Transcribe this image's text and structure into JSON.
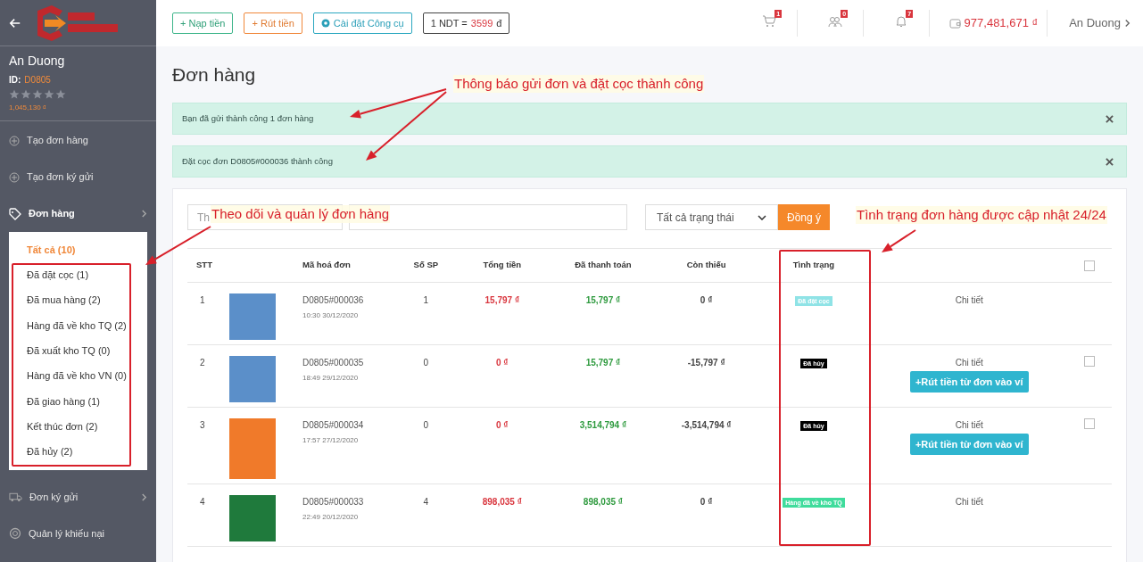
{
  "topbar": {
    "buttons": [
      {
        "label": "+ Nạp tiền",
        "kind": "deposit"
      },
      {
        "label": "+ Rút tiền",
        "kind": "withdraw"
      },
      {
        "label": "Cài đặt Công cụ",
        "kind": "tool"
      }
    ],
    "rate": {
      "label": "1 NDT =",
      "value": "3599",
      "unit": "đ"
    },
    "badges": [
      {
        "kind": "cart",
        "count": "1"
      },
      {
        "kind": "users",
        "count": "0"
      },
      {
        "kind": "bell",
        "count": "7"
      }
    ],
    "wallet": "977,481,671 ₫",
    "user": "An Duong"
  },
  "sidebar": {
    "name": "An Duong",
    "id_label": "ID:",
    "id": "D0805",
    "stars": 0,
    "balance": "1,045,130 ₫",
    "items": [
      {
        "label": "Tạo đơn hàng",
        "kind": "create",
        "expanded": false
      },
      {
        "label": "Tạo đơn ký gửi",
        "kind": "create",
        "expanded": false
      },
      {
        "label": "Đơn hàng",
        "kind": "orders",
        "expanded": true,
        "children": [
          {
            "label": "Tất cả (10)",
            "selected": true
          },
          {
            "label": "Đã đặt cọc (1)",
            "selected": false
          },
          {
            "label": "Đã mua hàng (2)",
            "selected": false
          },
          {
            "label": "Hàng đã về kho TQ (2)",
            "selected": false
          },
          {
            "label": "Đã xuất kho TQ (0)",
            "selected": false
          },
          {
            "label": "Hàng đã về kho VN (0)",
            "selected": false
          },
          {
            "label": "Đã giao hàng (1)",
            "selected": false
          },
          {
            "label": "Kết thúc đơn (2)",
            "selected": false
          },
          {
            "label": "Đã hủy (2)",
            "selected": false
          }
        ]
      },
      {
        "label": "Đơn ký gửi",
        "kind": "consignment",
        "expanded": false
      },
      {
        "label": "Quản lý khiếu nại",
        "kind": "complaints",
        "expanded": false
      }
    ]
  },
  "page_title": "Đơn hàng",
  "alerts": [
    "Bạn đã gửi thành công 1 đơn hàng",
    "Đặt cọc đơn D0805#000036 thành công"
  ],
  "filters": {
    "time_placeholder": "Th",
    "status_select": "Tất cả trạng thái",
    "submit": "Đồng ý"
  },
  "table": {
    "columns": [
      "STT",
      "Mã hoá đơn",
      "Số SP",
      "Tổng tiền",
      "Đã thanh toán",
      "Còn thiếu",
      "Tình trạng"
    ],
    "header_checked": false,
    "rows": [
      {
        "stt": "1",
        "code": "D0805#000036",
        "time": "10:30 30/12/2020",
        "qty": "1",
        "total": "15,797 ₫",
        "paid": "15,797 ₫",
        "owed": "0 ₫",
        "status": "Đã đặt cọc",
        "color": "#8fe3e6",
        "detail": "Chi tiết"
      },
      {
        "stt": "2",
        "code": "D0805#000035",
        "time": "18:49 29/12/2020",
        "qty": "0",
        "total": "0 ₫",
        "paid": "15,797 ₫",
        "owed": "-15,797 ₫",
        "status": "Đã hủy",
        "color": "#000000",
        "detail": "Chi tiết",
        "action": "+Rút tiền từ đơn vào ví",
        "checked": false
      },
      {
        "stt": "3",
        "code": "D0805#000034",
        "time": "17:57 27/12/2020",
        "qty": "0",
        "total": "0 ₫",
        "paid": "3,514,794 ₫",
        "owed": "-3,514,794 ₫",
        "status": "Đã hủy",
        "color": "#000000",
        "detail": "Chi tiết",
        "action": "+Rút tiền từ đơn vào ví",
        "checked": false
      },
      {
        "stt": "4",
        "code": "D0805#000033",
        "time": "22:49 20/12/2020",
        "qty": "4",
        "total": "898,035 ₫",
        "paid": "898,035 ₫",
        "owed": "0 ₫",
        "status": "Hàng đã về kho TQ",
        "color": "#3fdc9c",
        "detail": "Chi tiết"
      }
    ]
  },
  "annotations": [
    "Thông báo gửi đơn và đặt cọc thành công",
    "Theo dõi và quản lý đơn hàng",
    "Tình trạng đơn hàng được cập nhật 24/24"
  ]
}
